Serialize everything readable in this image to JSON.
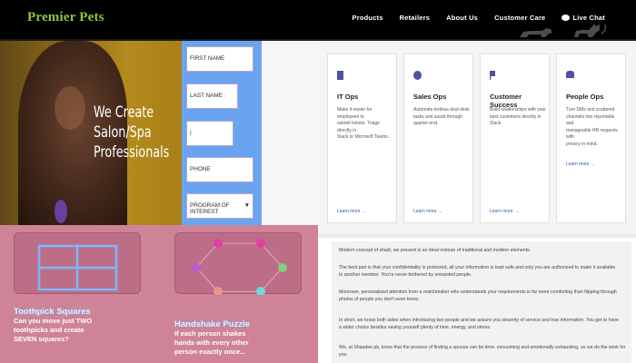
{
  "brand": {
    "name": "Premier Pets"
  },
  "nav": {
    "items": [
      "Products",
      "Retailers",
      "About Us",
      "Customer Care"
    ],
    "chat_label": "Live Chat"
  },
  "salon_ad": {
    "headline_lines": [
      "We Create",
      "Salon/Spa",
      "Professionals"
    ],
    "fields": [
      "FIRST NAME",
      "LAST NAME",
      "",
      "PHONE"
    ],
    "select_label": "PROGRAM OF INTEREST",
    "select_caret": "▼"
  },
  "puzzles": [
    {
      "title": "Toothpick Squares",
      "text_lines": [
        "Can you move just TWO",
        "toothpicks and create",
        "SEVEN squares?"
      ]
    },
    {
      "title": "Handshake Puzzle",
      "text_lines": [
        "If each person shakes",
        "hands with every other",
        "person exactly once..."
      ]
    }
  ],
  "cards": [
    {
      "icon": "document-icon",
      "title": "IT Ops",
      "text_lines": [
        "Make it easier for employees to",
        "submit tickets. Triage directly in",
        "Slack or Microsoft Teams."
      ],
      "link": "Learn more →"
    },
    {
      "icon": "sales-icon",
      "title": "Sales Ops",
      "text_lines": [
        "Automate tedious deal desk",
        "tasks and assist through",
        "quarter-end."
      ],
      "link": "Learn more →"
    },
    {
      "icon": "flag-icon",
      "title": "Customer Success",
      "text_lines": [
        "Build relationships with your",
        "best customers directly in Slack."
      ],
      "link": "Learn more →"
    },
    {
      "icon": "people-icon",
      "title": "People Ops",
      "text_lines": [
        "Turn DMs and scattered",
        "channels into reportable and",
        "manageable HR requests with",
        "privacy in mind."
      ],
      "link": "Learn more →"
    }
  ],
  "article": {
    "paragraphs": [
      [
        "Modern concept of shadi, we present is an ideal mixture of traditional and modern elements."
      ],
      [
        "The best part is that your confidentiality is protected, all your information is kept safe and only you are authorized to make it available",
        "to another member. You're never bothered by unwanted people."
      ],
      [
        "Moreover, personalized attention from a matchmaker who understands your requirements is far more comforting than flipping through",
        "photos of people you don't even know."
      ],
      [
        "In short, we know both sides when introducing two people and we assure you sincerity of service and true information. You get to have",
        "a wider choice besides saving yourself plenty of time, energy, and stress."
      ],
      [
        "We, at Shaadee.pk, know that the process of finding a spouse can be time- consuming and emotionally exhausting, so we do the work for",
        "you."
      ]
    ]
  },
  "colors": {
    "header_bg": "#000000",
    "brand_green": "#8cc63f",
    "form_blue": "#6aa4f0",
    "puzzle_pink": "#cf8397",
    "link_blue": "#2a5aa8"
  }
}
